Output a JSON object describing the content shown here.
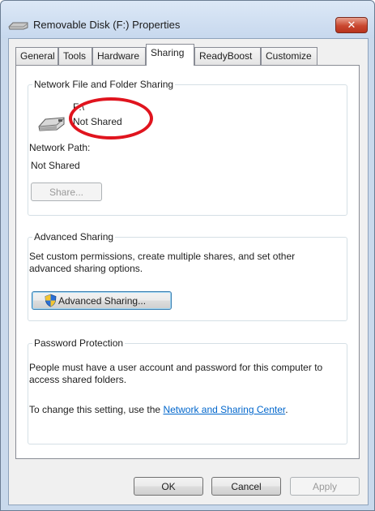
{
  "window": {
    "title": "Removable Disk (F:) Properties",
    "close_glyph": "✕",
    "accent": "#c9472f"
  },
  "tabs": [
    {
      "label": "General"
    },
    {
      "label": "Tools"
    },
    {
      "label": "Hardware"
    },
    {
      "label": "Sharing",
      "active": true
    },
    {
      "label": "ReadyBoost"
    },
    {
      "label": "Customize"
    }
  ],
  "network_sharing": {
    "title": "Network File and Folder Sharing",
    "drive_icon": "usb-drive-icon",
    "drive": "F:\\",
    "status": "Not Shared",
    "path_label": "Network Path:",
    "path_value": "Not Shared",
    "share_button": "Share..."
  },
  "advanced_sharing": {
    "title": "Advanced Sharing",
    "description": "Set custom permissions, create multiple shares, and set other advanced sharing options.",
    "button": "Advanced Sharing...",
    "button_icon": "uac-shield-icon"
  },
  "password_protection": {
    "title": "Password Protection",
    "description": "People must have a user account and password for this computer to access shared folders.",
    "change_prefix": "To change this setting, use the ",
    "link": "Network and Sharing Center",
    "change_suffix": "."
  },
  "footer": {
    "ok": "OK",
    "cancel": "Cancel",
    "apply": "Apply"
  }
}
